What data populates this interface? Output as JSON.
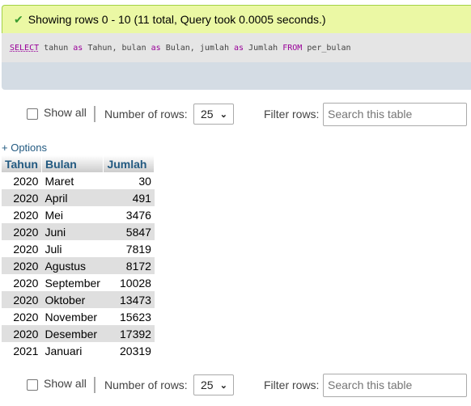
{
  "message": "Showing rows 0 - 10 (11 total, Query took 0.0005 seconds.)",
  "sql": {
    "select": "SELECT",
    "p1": " tahun ",
    "as": "as",
    "p2": " Tahun, bulan ",
    "p3": " Bulan, jumlah ",
    "p4": " Jumlah ",
    "from": "FROM",
    "p5": " per_bulan"
  },
  "nav": {
    "show_all": "Show all",
    "rows_label": "Number of rows:",
    "rows_value": "25",
    "filter_label": "Filter rows:",
    "search_placeholder": "Search this table"
  },
  "options": "+ Options",
  "table": {
    "headers": [
      "Tahun",
      "Bulan",
      "Jumlah"
    ],
    "rows": [
      [
        "2020",
        "Maret",
        "30"
      ],
      [
        "2020",
        "April",
        "491"
      ],
      [
        "2020",
        "Mei",
        "3476"
      ],
      [
        "2020",
        "Juni",
        "5847"
      ],
      [
        "2020",
        "Juli",
        "7819"
      ],
      [
        "2020",
        "Agustus",
        "8172"
      ],
      [
        "2020",
        "September",
        "10028"
      ],
      [
        "2020",
        "Oktober",
        "13473"
      ],
      [
        "2020",
        "November",
        "15623"
      ],
      [
        "2020",
        "Desember",
        "17392"
      ],
      [
        "2021",
        "Januari",
        "20319"
      ]
    ]
  }
}
